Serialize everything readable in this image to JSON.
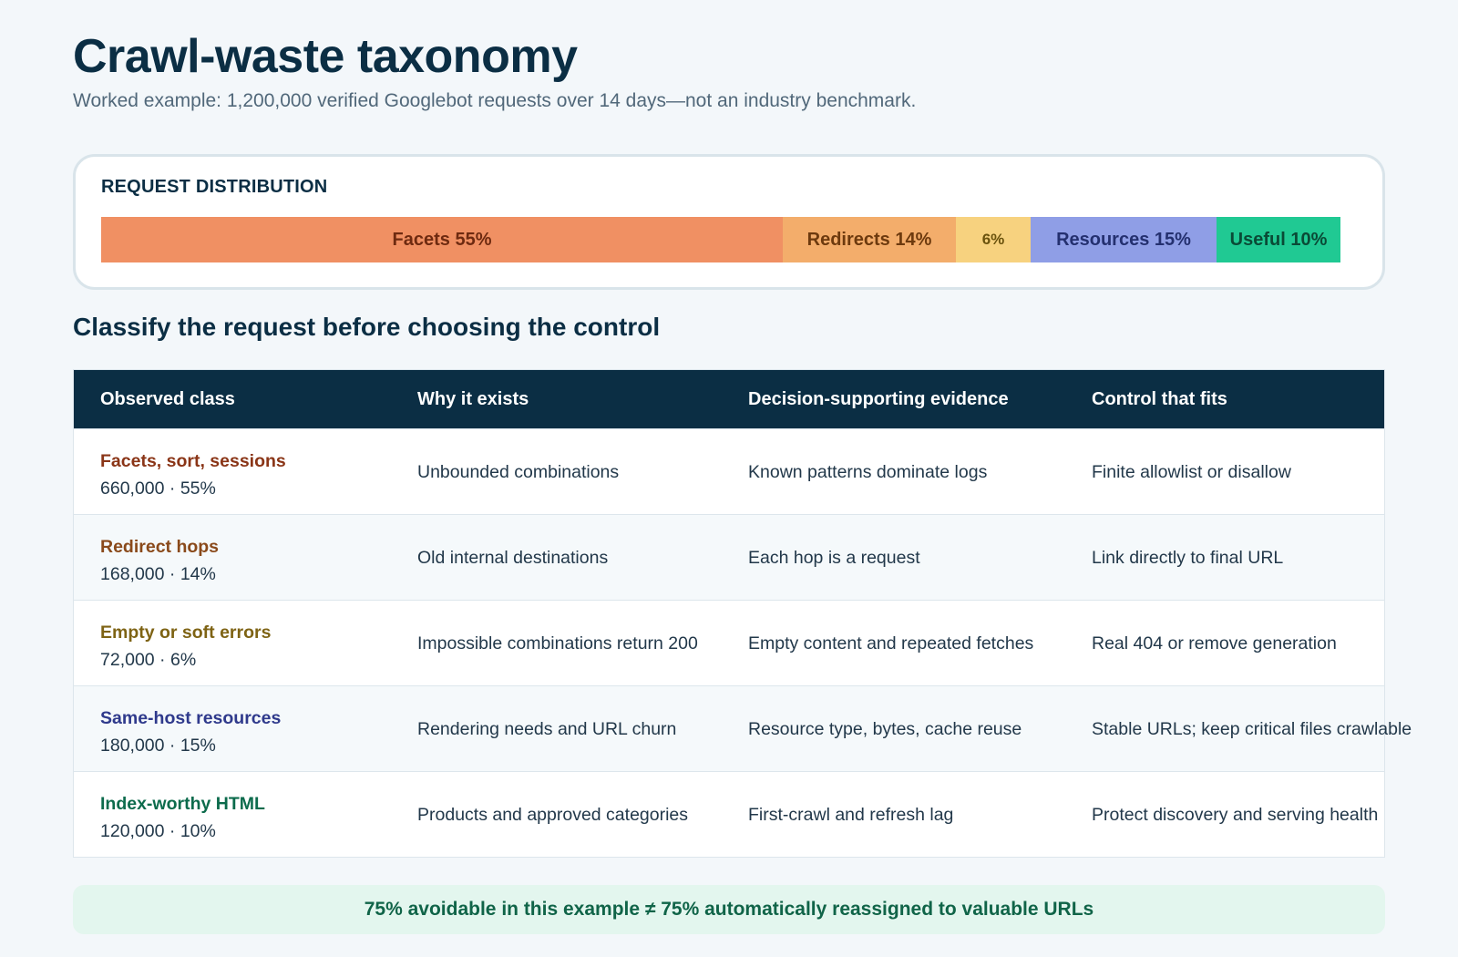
{
  "header": {
    "title": "Crawl-waste taxonomy",
    "subtitle": "Worked example: 1,200,000 verified Googlebot requests over 14 days—not an industry benchmark."
  },
  "distribution": {
    "label": "REQUEST DISTRIBUTION"
  },
  "chart_data": {
    "type": "bar",
    "orientation": "horizontal-stacked",
    "total": 100,
    "series": [
      {
        "label": "Facets 55%",
        "value": 55,
        "color": "#f09063",
        "text_color": "#6e2a10"
      },
      {
        "label": "Redirects 14%",
        "value": 14,
        "color": "#f3ad6b",
        "text_color": "#6d3a0e"
      },
      {
        "label": "6%",
        "value": 6,
        "color": "#f7d27f",
        "text_color": "#6a520d"
      },
      {
        "label": "Resources 15%",
        "value": 15,
        "color": "#8f9ee6",
        "text_color": "#24306f"
      },
      {
        "label": "Useful 10%",
        "value": 10,
        "color": "#20c993",
        "text_color": "#0a4a36"
      }
    ]
  },
  "section": {
    "title": "Classify the request before choosing the control"
  },
  "table": {
    "columns": [
      "Observed class",
      "Why it exists",
      "Decision-supporting evidence",
      "Control that fits"
    ],
    "rows": [
      {
        "name": "Facets, sort, sessions",
        "stat": "660,000 · 55%",
        "why": "Unbounded combinations",
        "evidence": "Known patterns dominate logs",
        "control": "Finite allowlist or disallow",
        "color": "#8a3517"
      },
      {
        "name": "Redirect hops",
        "stat": "168,000 · 14%",
        "why": "Old internal destinations",
        "evidence": "Each hop is a request",
        "control": "Link directly to final URL",
        "color": "#8a4a1b"
      },
      {
        "name": "Empty or soft errors",
        "stat": "72,000 · 6%",
        "why": "Impossible combinations return 200",
        "evidence": "Empty content and repeated fetches",
        "control": "Real 404 or remove generation",
        "color": "#7e6314"
      },
      {
        "name": "Same-host resources",
        "stat": "180,000 · 15%",
        "why": "Rendering needs and URL churn",
        "evidence": "Resource type, bytes, cache reuse",
        "control": "Stable URLs; keep critical files crawlable",
        "color": "#2f3a8c"
      },
      {
        "name": "Index-worthy HTML",
        "stat": "120,000 · 10%",
        "why": "Products and approved categories",
        "evidence": "First-crawl and refresh lag",
        "control": "Protect discovery and serving health",
        "color": "#0c6b4c"
      }
    ]
  },
  "footer_note": "75% avoidable in this example ≠ 75% automatically reassigned to valuable URLs"
}
